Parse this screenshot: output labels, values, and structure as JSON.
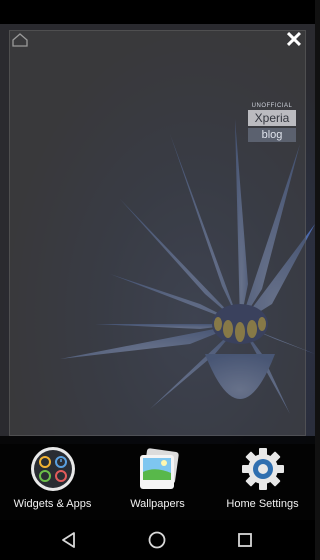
{
  "panel": {
    "home_icon": "home-outline-icon",
    "close_label": "✕"
  },
  "watermark": {
    "line1": "UNOFFICIAL",
    "line2": "Xperia",
    "line3": "blog"
  },
  "options": [
    {
      "label": "Widgets & Apps",
      "icon": "widgets-apps-icon"
    },
    {
      "label": "Wallpapers",
      "icon": "wallpapers-icon"
    },
    {
      "label": "Home Settings",
      "icon": "gear-icon"
    }
  ],
  "nav": {
    "back_icon": "back-triangle-icon",
    "home_icon": "home-circle-icon",
    "recents_icon": "recents-square-icon"
  },
  "colors": {
    "accent_blue": "#2f6fb0",
    "panel_overlay": "#464646",
    "flower": "#6f8fd6"
  }
}
